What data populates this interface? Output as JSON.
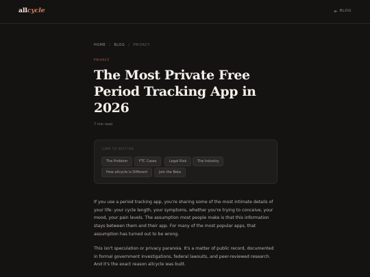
{
  "header": {
    "logo_main": "all",
    "logo_accent": "cycle",
    "back_icon": "arrow-left-icon",
    "back_label": "BLOG"
  },
  "breadcrumb": {
    "home": "HOME",
    "sep1": "/",
    "blog": "BLOG",
    "sep2": "/",
    "current": "PRIVACY"
  },
  "article": {
    "category": "PRIVACY",
    "title": "The Most Private Free Period Tracking App in 2026",
    "read_time": "7 min read",
    "paragraphs": [
      "If you use a period tracking app, you're sharing some of the most intimate details of your life: your cycle length, your symptoms, whether you're trying to conceive, your mood, your pain levels. The assumption most people make is that this information stays between them and their app. For many of the most popular apps, that assumption has turned out to be wrong.",
      "This isn't speculation or privacy paranoia. It's a matter of public record, documented in formal government investigations, federal lawsuits, and peer-reviewed research. And it's the exact reason allcycle was built."
    ]
  },
  "toc": {
    "label": "JUMP TO SECTION",
    "items": [
      "The Problem",
      "FTC Cases",
      "Legal Risk",
      "The Industry",
      "How allcycle is Different",
      "Join the Beta"
    ]
  },
  "colors": {
    "background": "#141312",
    "accent": "#c97a5e",
    "category": "#b8694f",
    "chip_bg": "#2a2826"
  }
}
